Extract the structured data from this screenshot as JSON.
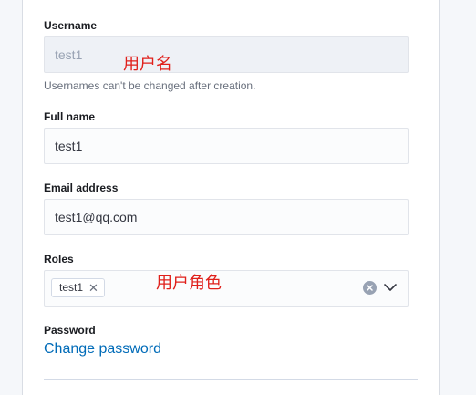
{
  "form": {
    "username": {
      "label": "Username",
      "value": "test1",
      "help": "Usernames can't be changed after creation."
    },
    "full_name": {
      "label": "Full name",
      "value": "test1"
    },
    "email": {
      "label": "Email address",
      "value": "test1@qq.com"
    },
    "roles": {
      "label": "Roles",
      "chips": [
        "test1"
      ],
      "chip_remove_glyph": "✕"
    },
    "password": {
      "label": "Password",
      "link": "Change password"
    }
  },
  "annotations": {
    "username_note": "用户名",
    "roles_note": "用户角色"
  },
  "colors": {
    "annotation": "#e0201b",
    "link": "#006bb8"
  }
}
